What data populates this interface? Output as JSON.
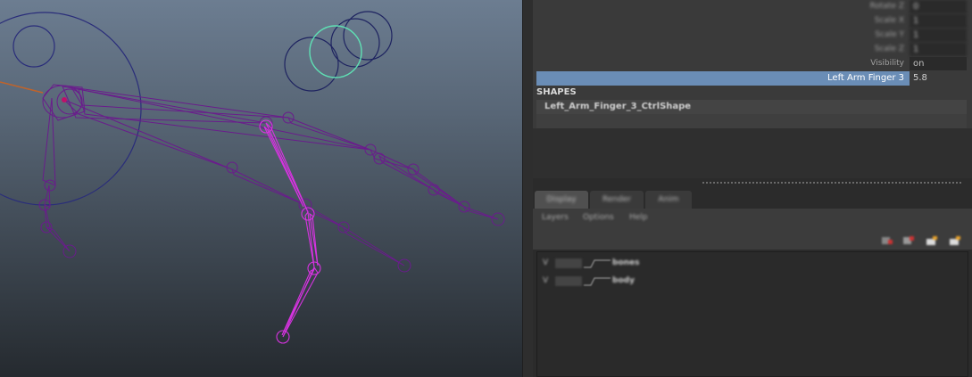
{
  "viewport": {
    "colors": {
      "joint": "#6a1c8c",
      "selected": "#d633e0",
      "control": "#2a2d7a",
      "highlight": "#5fe0b4"
    }
  },
  "attribute_editor": {
    "rows": [
      {
        "label": "Rotate Z",
        "value": "0"
      },
      {
        "label": "Scale X",
        "value": "1"
      },
      {
        "label": "Scale Y",
        "value": "1"
      },
      {
        "label": "Scale Z",
        "value": "1"
      },
      {
        "label": "Visibility",
        "value": "on"
      }
    ],
    "selected_row": {
      "label": "Left Arm Finger 3",
      "value": "5.8"
    },
    "shapes_title": "SHAPES",
    "shape_name": "Left_Arm_Finger_3_CtrlShape"
  },
  "layer_editor": {
    "tabs": [
      "Display",
      "Render",
      "Anim"
    ],
    "menu": [
      "Layers",
      "Options",
      "Help"
    ],
    "tool_icons": [
      "new-layer-icon",
      "new-layer-selected-icon",
      "move-up-icon",
      "move-down-icon"
    ],
    "layers": [
      {
        "visible": "V",
        "name": "bones"
      },
      {
        "visible": "V",
        "name": "body"
      }
    ]
  }
}
